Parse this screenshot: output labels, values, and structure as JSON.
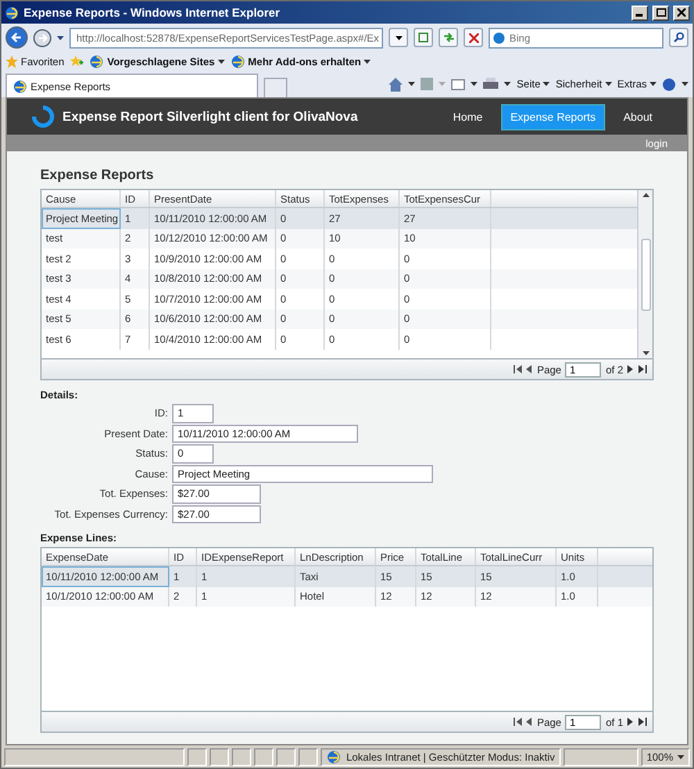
{
  "window": {
    "title": "Expense Reports - Windows Internet Explorer"
  },
  "address_bar": {
    "value": "http://localhost:52878/ExpenseReportServicesTestPage.aspx#/Ex"
  },
  "search": {
    "placeholder": "Bing"
  },
  "favorites_bar": {
    "label": "Favoriten",
    "links": [
      "Vorgeschlagene Sites",
      "Mehr Add-ons erhalten"
    ]
  },
  "tabs": [
    {
      "label": "Expense Reports",
      "selected": true
    }
  ],
  "command_bar": [
    "Seite",
    "Sicherheit",
    "Extras"
  ],
  "app": {
    "title": "Expense Report Silverlight client for OlivaNova",
    "nav": [
      {
        "label": "Home",
        "selected": false
      },
      {
        "label": "Expense Reports",
        "selected": true
      },
      {
        "label": "About",
        "selected": false
      }
    ],
    "login": "login"
  },
  "reports": {
    "heading": "Expense Reports",
    "columns": [
      "Cause",
      "ID",
      "PresentDate",
      "Status",
      "TotExpenses",
      "TotExpensesCur"
    ],
    "rows": [
      {
        "cells": [
          "Project Meeting",
          "1",
          "10/11/2010 12:00:00 AM",
          "0",
          "27",
          "27"
        ],
        "selected": true
      },
      {
        "cells": [
          "test",
          "2",
          "10/12/2010 12:00:00 AM",
          "0",
          "10",
          "10"
        ],
        "selected": false
      },
      {
        "cells": [
          "test 2",
          "3",
          "10/9/2010 12:00:00 AM",
          "0",
          "0",
          "0"
        ],
        "selected": false
      },
      {
        "cells": [
          "test 3",
          "4",
          "10/8/2010 12:00:00 AM",
          "0",
          "0",
          "0"
        ],
        "selected": false
      },
      {
        "cells": [
          "test 4",
          "5",
          "10/7/2010 12:00:00 AM",
          "0",
          "0",
          "0"
        ],
        "selected": false
      },
      {
        "cells": [
          "test 5",
          "6",
          "10/6/2010 12:00:00 AM",
          "0",
          "0",
          "0"
        ],
        "selected": false
      },
      {
        "cells": [
          "test 6",
          "7",
          "10/4/2010 12:00:00 AM",
          "0",
          "0",
          "0"
        ],
        "selected": false
      }
    ],
    "pager": {
      "label": "Page",
      "page": "1",
      "of": "of 2"
    }
  },
  "details": {
    "heading": "Details:",
    "fields": [
      {
        "label": "ID:",
        "value": "1"
      },
      {
        "label": "Present Date:",
        "value": "10/11/2010 12:00:00 AM"
      },
      {
        "label": "Status:",
        "value": "0"
      },
      {
        "label": "Cause:",
        "value": "Project Meeting"
      },
      {
        "label": "Tot. Expenses:",
        "value": "$27.00"
      },
      {
        "label": "Tot. Expenses Currency:",
        "value": "$27.00"
      }
    ]
  },
  "lines": {
    "heading": "Expense Lines:",
    "columns": [
      "ExpenseDate",
      "ID",
      "IDExpenseReport",
      "LnDescription",
      "Price",
      "TotalLine",
      "TotalLineCurr",
      "Units"
    ],
    "rows": [
      {
        "cells": [
          "10/11/2010 12:00:00 AM",
          "1",
          "1",
          "Taxi",
          "15",
          "15",
          "15",
          "1.0"
        ],
        "selected": true
      },
      {
        "cells": [
          "10/1/2010 12:00:00 AM",
          "2",
          "1",
          "Hotel",
          "12",
          "12",
          "12",
          "1.0"
        ],
        "selected": false
      }
    ],
    "pager": {
      "label": "Page",
      "page": "1",
      "of": "of 1"
    }
  },
  "status_bar": {
    "zone": "Lokales Intranet | Geschützter Modus: Inaktiv",
    "zoom": "100%"
  }
}
